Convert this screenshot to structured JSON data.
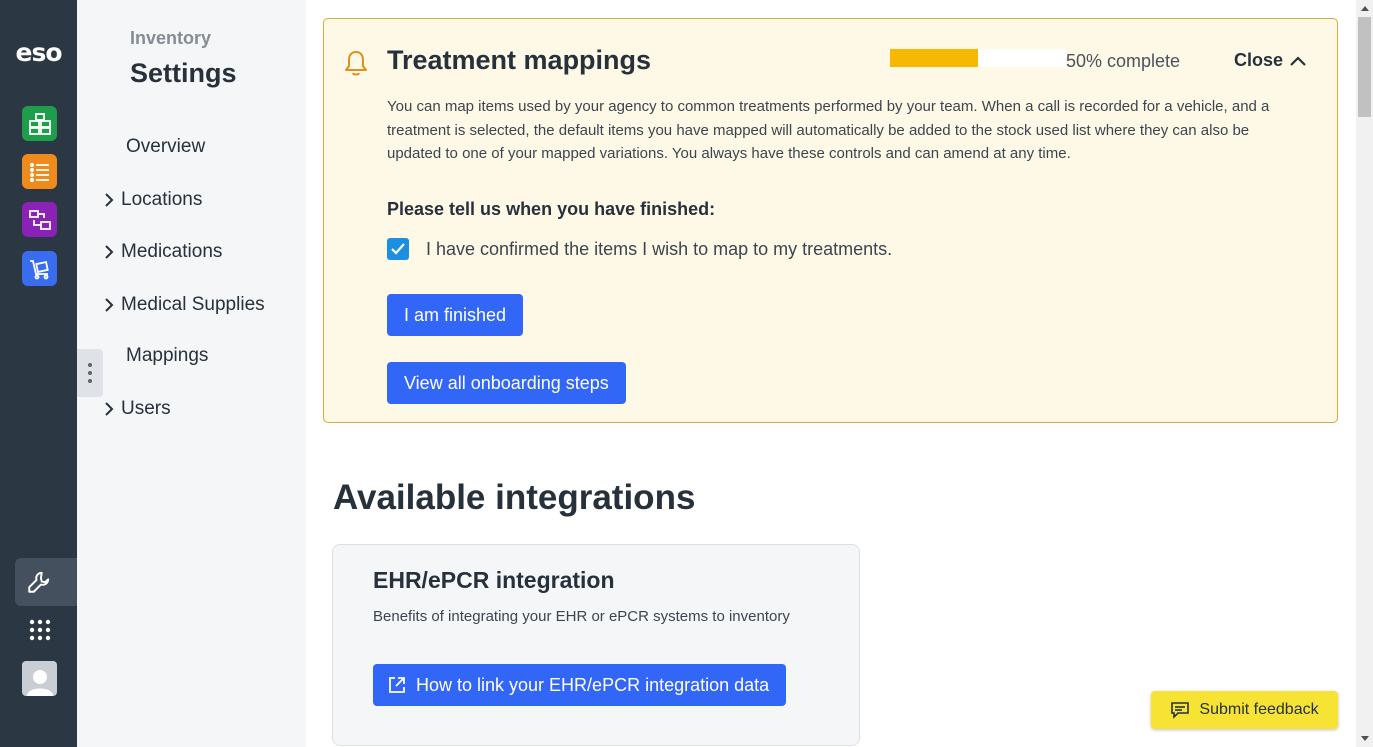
{
  "rail": {
    "logo": "eso",
    "apps": [
      {
        "name": "grid-app-icon",
        "color": "#1e9e4a"
      },
      {
        "name": "list-app-icon",
        "color": "#f08a1c"
      },
      {
        "name": "transfer-app-icon",
        "color": "#8a22b5"
      },
      {
        "name": "cart-app-icon",
        "color": "#3a6cf0"
      }
    ]
  },
  "sidebar": {
    "supertitle": "Inventory",
    "title": "Settings",
    "items": [
      {
        "label": "Overview"
      },
      {
        "label": "Locations"
      },
      {
        "label": "Medications"
      },
      {
        "label": "Medical Supplies"
      },
      {
        "label": "Mappings"
      },
      {
        "label": "Users"
      }
    ]
  },
  "banner": {
    "title": "Treatment mappings",
    "progress_percent": 50,
    "progress_label": "50% complete",
    "close_label": "Close",
    "description": "You can map items used by your agency to common treatments performed by your team. When a call is recorded for a vehicle, and a treatment is selected, the default items you have mapped will automatically be added to the stock used list where they can also be updated to one of your mapped variations. You always have these controls and can amend at any time.",
    "prompt": "Please tell us when you have finished:",
    "checkbox_label": "I have confirmed the items I wish to map to my treatments.",
    "checkbox_checked": true,
    "finish_button": "I am finished",
    "view_steps_button": "View all onboarding steps"
  },
  "integrations": {
    "section_title": "Available integrations",
    "card": {
      "title": "EHR/ePCR integration",
      "description": "Benefits of integrating your EHR or ePCR systems to inventory",
      "button": "How to link your EHR/ePCR integration data"
    }
  },
  "feedback": {
    "label": "Submit feedback"
  },
  "colors": {
    "accent": "#3266f6",
    "banner_bg": "#fef8e7",
    "banner_border": "#d8a93c",
    "progress": "#f6b800",
    "feedback": "#f7e334",
    "rail": "#2c3744"
  }
}
